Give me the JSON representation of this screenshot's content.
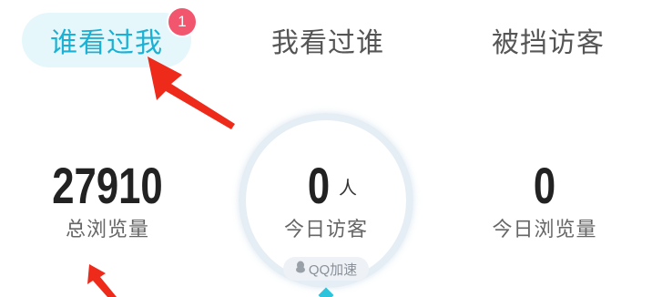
{
  "tabs": [
    {
      "label": "谁看过我",
      "active": true,
      "badge": "1"
    },
    {
      "label": "我看过谁",
      "active": false
    },
    {
      "label": "被挡访客",
      "active": false
    }
  ],
  "stats": {
    "total_views": {
      "value": "27910",
      "label": "总浏览量"
    },
    "today_visitors": {
      "value": "0",
      "unit": "人",
      "label": "今日访客"
    },
    "today_views": {
      "value": "0",
      "label": "今日浏览量"
    }
  },
  "qq_boost": {
    "label": "QQ加速",
    "icon": "qq-penguin-icon"
  },
  "colors": {
    "accent": "#1ab1d4",
    "active_tab_bg": "#e6f7fb",
    "badge": "#f2566f",
    "annotation_arrow": "#ee2a1b"
  }
}
